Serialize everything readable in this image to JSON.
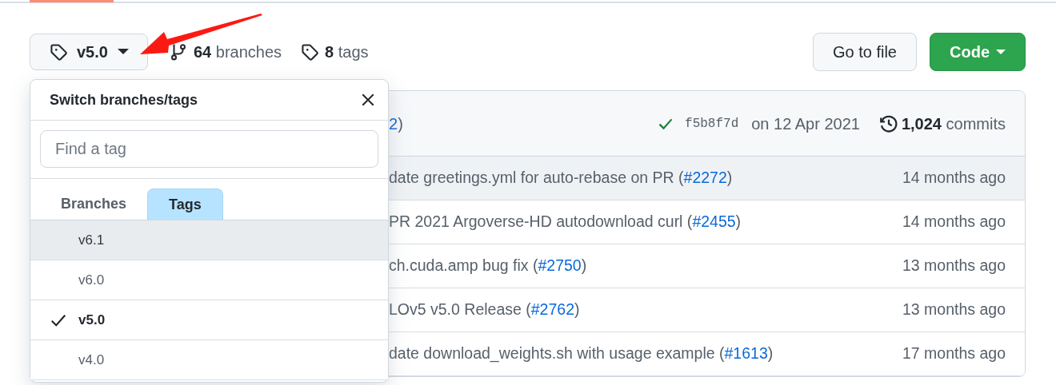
{
  "ref_button": {
    "label": "v5.0"
  },
  "branches": {
    "count": "64",
    "label": "branches"
  },
  "tags": {
    "count": "8",
    "label": "tags"
  },
  "buttons": [
    {
      "label": "Go to file",
      "kind": "default"
    },
    {
      "label": "Code",
      "kind": "primary"
    }
  ],
  "latest_commit": {
    "message_link": "2",
    "message_end": ")",
    "checks_passed": true,
    "sha": "f5b8f7d",
    "date": "on 12 Apr 2021",
    "commit_count": "1,024",
    "commit_label": "commits"
  },
  "files": [
    {
      "message": "date greetings.yml for auto-rebase on PR (",
      "pr": "#2272",
      "message_end": ")",
      "age": "14 months ago",
      "highlighted": true
    },
    {
      "message": "PR 2021 Argoverse-HD autodownload curl (",
      "pr": "#2455",
      "message_end": ")",
      "age": "14 months ago",
      "highlighted": false
    },
    {
      "message": "ch.cuda.amp bug fix (",
      "pr": "#2750",
      "message_end": ")",
      "age": "13 months ago",
      "highlighted": false
    },
    {
      "message": "LOv5 v5.0 Release (",
      "pr": "#2762",
      "message_end": ")",
      "age": "13 months ago",
      "highlighted": false
    },
    {
      "message": "date download_weights.sh with usage example (",
      "pr": "#1613",
      "message_end": ")",
      "age": "17 months ago",
      "highlighted": false
    }
  ],
  "dropdown": {
    "title": "Switch branches/tags",
    "search": {
      "placeholder": "Find a tag"
    },
    "tabs": [
      {
        "label": "Branches",
        "selected": false
      },
      {
        "label": "Tags",
        "selected": true
      }
    ],
    "items": [
      {
        "label": "v6.1",
        "checked": false,
        "highlighted": true
      },
      {
        "label": "v6.0",
        "checked": false,
        "highlighted": false
      },
      {
        "label": "v5.0",
        "checked": true,
        "highlighted": false
      },
      {
        "label": "v4.0",
        "checked": false,
        "highlighted": false
      }
    ]
  }
}
